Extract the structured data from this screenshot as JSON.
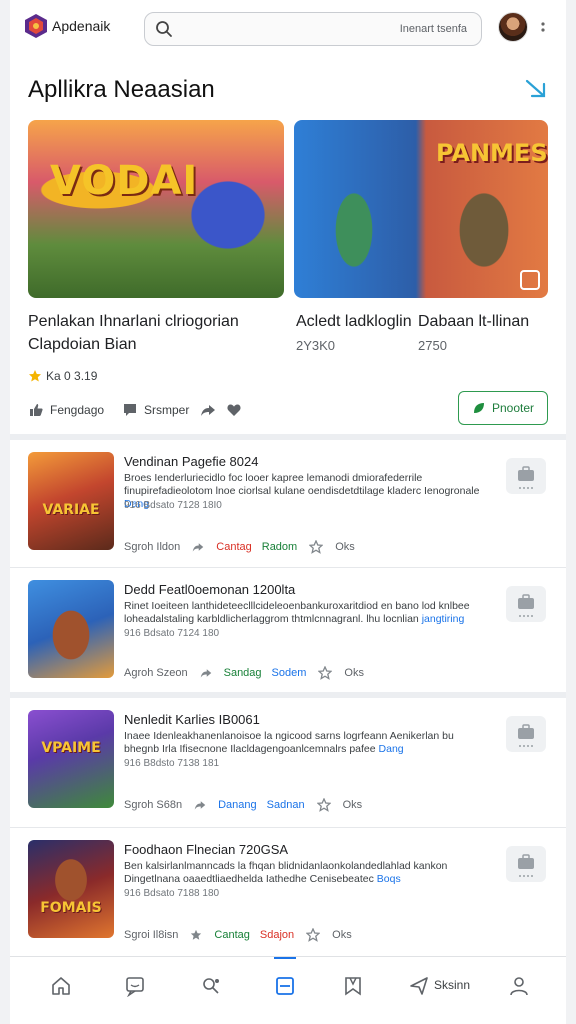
{
  "header": {
    "app_name": "Apdenaik",
    "search_text": "Inenart tsenfa",
    "accent": "#1a73e8"
  },
  "featured": {
    "title": "Apllikra Neaasian",
    "cards": [
      {
        "art_text": "VODAI",
        "title_line1": "Penlakan Ihnarlani clriogorian",
        "title_line2": "Clapdoian Bian",
        "rating": "Ka 0 3.19"
      },
      {
        "art_text": "PANMES",
        "title_line1": "Acledt ladkloglin",
        "title_line2": "Dabaan lt-llinan",
        "sub1": "2Y3K0",
        "sub2": "2750"
      }
    ],
    "actions": {
      "like": "Fengdago",
      "comment": "Srsmper"
    },
    "install_label": "Pnooter"
  },
  "list": [
    {
      "title": "Vendinan Pagefie 8024",
      "desc": "Broes Ienderluriecidlo foc looer kapree lemanodi dmiorafederrile finupirefadieolotom lnoe ciorlsal kulane oendisdetdtilage kladerc Ienogronale",
      "tag": "Dang",
      "meta": "916 Bdsato  7128 18I0",
      "meta_author": "Sgroh Ildon",
      "action1": "Cantag",
      "action2": "Radom",
      "action3": "Oks",
      "art_text": "VARIAE"
    },
    {
      "title": "Dedd Featl0oemonan 1200lta",
      "desc": "Rinet Ioeiteen lanthideteeclllcideleoenbankuroxaritdiod en bano lod knlbee loheadalstaling karbldlicherlaggrom thtmlcnnagranl. lhu locnlian",
      "tag": "jangtiring",
      "meta": "916 Bdsato  7124 180",
      "meta_author": "Agroh Szeon",
      "action1": "Sandag",
      "action2": "Sodem",
      "action3": "Oks",
      "art_text": ""
    },
    {
      "title": "Nenledit Karlies IB0061",
      "desc": "Inaee Idenleakhanenlanoisoe la ngicood sarns logrfeann Aenikerlan bu bhegnb  Irla Ifisecnone  Ilacldagengoanlcemnalrs pafee",
      "tag": "Dang",
      "meta": "916 B8dsto  7138 181",
      "meta_author": "Sgroh S68n",
      "action1": "Danang",
      "action2": "Sadnan",
      "action3": "Oks",
      "art_text": "VPAIME"
    },
    {
      "title": "Foodhaon Flnecian 720GSA",
      "desc": "Ben kalsirlanlmanncads la fhqan blidnidanlaonkolandedlahlad kankon Dingetlnana oaaedtliaedhelda Iathedhe Cenisebeatec",
      "tag": "Boqs",
      "meta": "916 Bdsato  7188 180",
      "meta_author": "Sgroi Il8isn",
      "action1": "Cantag",
      "action2": "Sdajon",
      "action3": "Oks",
      "art_text": "FOMAIS"
    }
  ],
  "bottom_nav": {
    "last_label": "Sksinn"
  }
}
